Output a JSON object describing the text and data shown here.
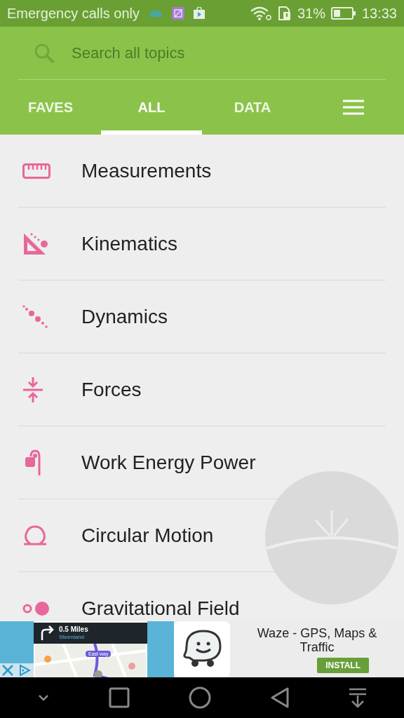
{
  "status_bar": {
    "carrier": "Emergency calls only",
    "battery": "31%",
    "time": "13:33"
  },
  "search": {
    "placeholder": "Search all topics"
  },
  "tabs": [
    {
      "label": "FAVES",
      "selected": false
    },
    {
      "label": "ALL",
      "selected": true
    },
    {
      "label": "DATA",
      "selected": false
    }
  ],
  "topics": [
    {
      "label": "Measurements"
    },
    {
      "label": "Kinematics"
    },
    {
      "label": "Dynamics"
    },
    {
      "label": "Forces"
    },
    {
      "label": "Work Energy Power"
    },
    {
      "label": "Circular Motion"
    },
    {
      "label": "Gravitational Field"
    }
  ],
  "ad": {
    "screenshot": {
      "distance": "0.5 Miles",
      "street": "Steenland",
      "route": "East way"
    },
    "title": "Waze - GPS, Maps & Traffic",
    "button": "INSTALL"
  }
}
